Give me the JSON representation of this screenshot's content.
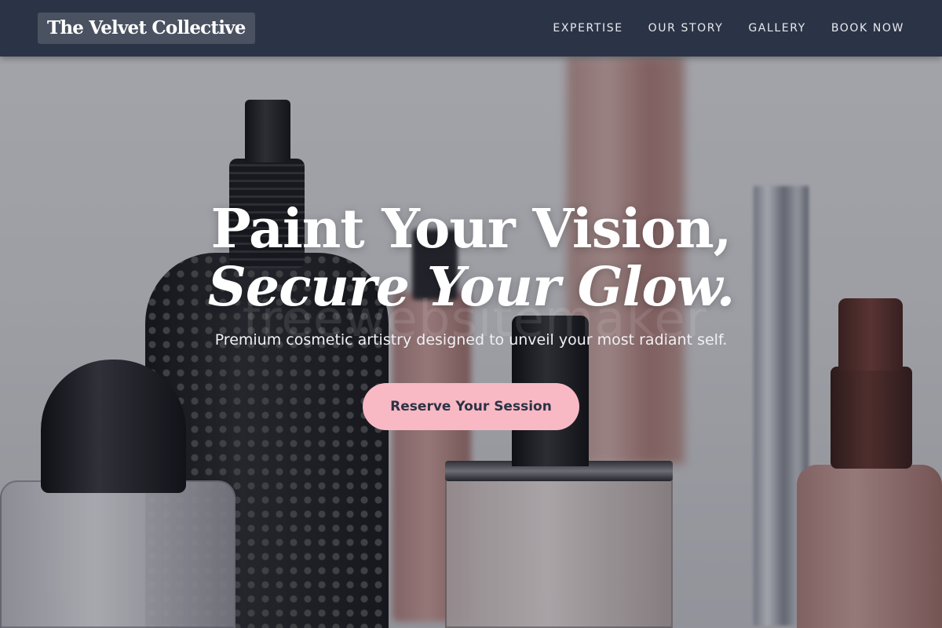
{
  "header": {
    "brand": "The Velvet Collective",
    "nav": [
      {
        "label": "EXPERTISE"
      },
      {
        "label": "OUR STORY"
      },
      {
        "label": "GALLERY"
      },
      {
        "label": "BOOK NOW"
      }
    ]
  },
  "hero": {
    "headline_line1": "Paint Your Vision,",
    "headline_line2": "Secure Your Glow.",
    "subtitle": "Premium cosmetic artistry designed to unveil your most radiant self.",
    "cta_label": "Reserve Your Session",
    "watermark": "freewebsitemaker"
  },
  "colors": {
    "header_bg": "#2b3446",
    "cta_bg": "#f8b9c4",
    "cta_text": "#2b3446"
  }
}
